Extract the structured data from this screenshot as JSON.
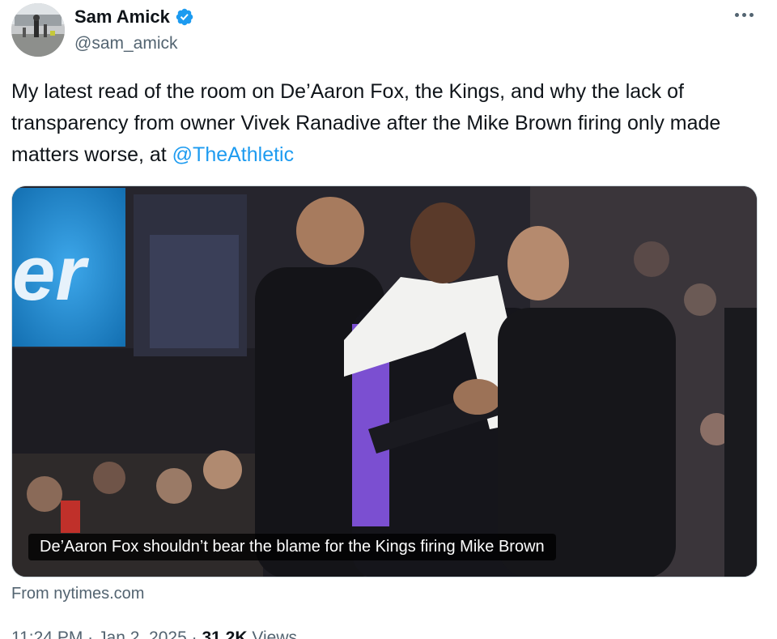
{
  "author": {
    "display_name": "Sam Amick",
    "handle": "@sam_amick",
    "verified": true,
    "verified_color": "#1d9bf0"
  },
  "more_icon": "more-horizontal-icon",
  "tweet": {
    "text": "My latest read of the room on De’Aaron Fox, the Kings, and why the lack of transparency from owner Vivek Ranadive after the Mike Brown firing only made matters worse, at ",
    "mention": "@TheAthletic"
  },
  "link_card": {
    "caption": "De’Aaron Fox shouldn’t bear the blame for the Kings firing Mike Brown",
    "scoreboard_text": "er",
    "source": "From nytimes.com"
  },
  "meta": {
    "time": "11:24 PM",
    "separator": "·",
    "date": "Jan 2, 2025",
    "views_count": "31.2K",
    "views_label": "Views"
  },
  "colors": {
    "text_primary": "#0f1419",
    "text_secondary": "#536471",
    "link": "#1d9bf0",
    "kings_purple": "#7b4fd1"
  }
}
